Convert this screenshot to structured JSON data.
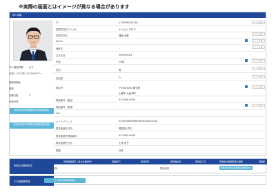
{
  "notice": "※実際の画面とはイメージが異なる場合があります",
  "section_title": "本人情報",
  "left": {
    "lines": [
      {
        "label": "本人確認書類",
        "value": "あり"
      },
      {
        "label": "利用レベル",
        "value": "1 (防) 2020/04/07～"
      },
      {
        "label": "健康保険者",
        "value": ""
      },
      {
        "label": "郵便",
        "value": ""
      },
      {
        "label": "前職日数",
        "value": "0"
      },
      {
        "label": "利用状態",
        "value": ""
      }
    ],
    "btn_address": "区役所申請事項閲覧(住居情報変更)",
    "btn_contact": "区役所申請事項閲覧(緊急連絡先変更)"
  },
  "fields": [
    {
      "label": "ID",
      "value": "1178992202401"
    },
    {
      "label": "従業員氏名フリガナ",
      "value": "ケンセツ タロウ"
    },
    {
      "label": "従業員氏名",
      "value": "建設 太郎"
    },
    {
      "label": "Name",
      "value": "-"
    },
    {
      "label": "通称名",
      "value": "-"
    },
    {
      "label": "生年月日",
      "value": "2000/01/01"
    },
    {
      "label": "年齢",
      "value": "25歳"
    },
    {
      "label": "性別",
      "value": "男"
    },
    {
      "label": "血液型",
      "value": "O"
    },
    {
      "label": "現住所",
      "value": "〒160-0000 埼玉県"
    },
    {
      "label": "",
      "value": "上尾市 大谷本町"
    },
    {
      "label": "電話番号（固定）",
      "value": "03-0000-0000"
    },
    {
      "label": "電話番号（携帯）",
      "value": "-"
    },
    {
      "label": "FAX",
      "value": "-"
    },
    {
      "label": "メールアドレス",
      "value": "m_kensetsu@kensetsu.kikin.or.jp"
    },
    {
      "label": "緊急連絡先住所",
      "value": "現住所と同じ"
    },
    {
      "label": "緊急連絡先電話番号",
      "value": "03-0000-0000"
    },
    {
      "label": "緊急連絡先氏名",
      "value": "土木 花子"
    },
    {
      "label": "国籍",
      "value": "日本"
    }
  ],
  "employment": {
    "header": "所属会社登録事項",
    "columns": [
      "所属事業者名（基本企業番号）",
      "事業者ID",
      "雇用形態",
      "雇用開始日",
      "雇用終了日",
      "所属会社登録事項の閲覧",
      "事業所"
    ],
    "row": [
      "アップ工業（株）",
      "-",
      "",
      "同社着用",
      "-",
      "",
      "-"
    ],
    "view_button": "所属会社登録事項閲覧(所属会社)"
  },
  "other": {
    "header": "その他登録事項",
    "button": "その他の登録事項閲覧"
  },
  "colors": {
    "header": "#20489a",
    "button": "#5ab5d6",
    "accent": "#2f80b8"
  }
}
